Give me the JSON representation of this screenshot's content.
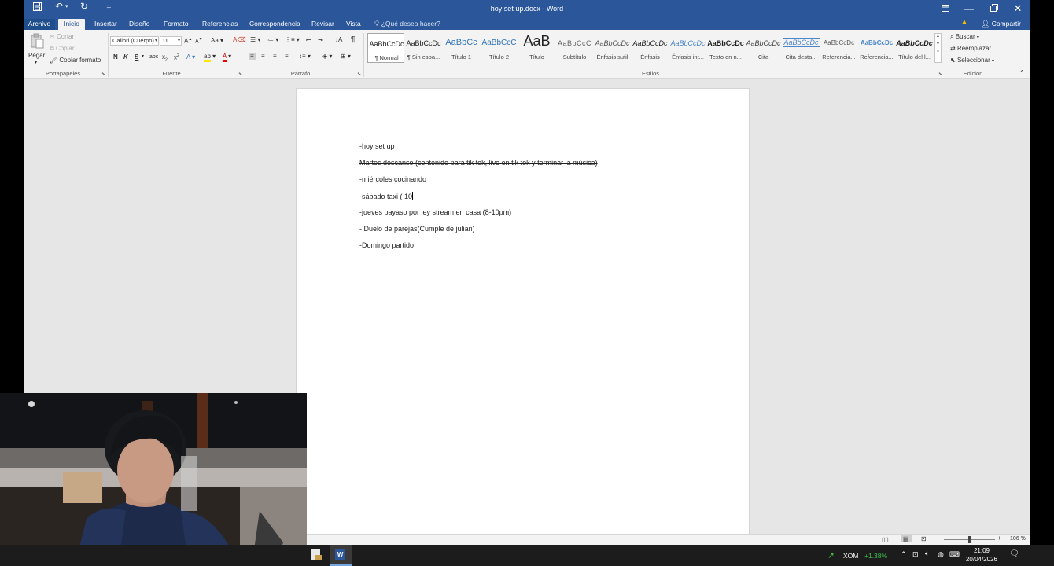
{
  "window": {
    "title": "hoy set up.docx - Word"
  },
  "tabs": [
    {
      "label": "Archivo"
    },
    {
      "label": "Inicio"
    },
    {
      "label": "Insertar"
    },
    {
      "label": "Diseño"
    },
    {
      "label": "Formato"
    },
    {
      "label": "Referencias"
    },
    {
      "label": "Correspondencia"
    },
    {
      "label": "Revisar"
    },
    {
      "label": "Vista"
    }
  ],
  "tell_me": "¿Qué desea hacer?",
  "share_label": "Compartir",
  "ribbon": {
    "clipboard": {
      "paste": "Pegar",
      "cut": "Cortar",
      "copy": "Copiar",
      "format_painter": "Copiar formato",
      "group": "Portapapeles"
    },
    "font": {
      "family": "Calibri (Cuerpo)",
      "size": "11",
      "group": "Fuente"
    },
    "paragraph": {
      "group": "Párrafo"
    },
    "styles": {
      "group": "Estilos",
      "items": [
        {
          "preview": "AaBbCcDc",
          "name": "¶ Normal"
        },
        {
          "preview": "AaBbCcDc",
          "name": "¶ Sin espa..."
        },
        {
          "preview": "AaBbCc",
          "name": "Título 1"
        },
        {
          "preview": "AaBbCcC",
          "name": "Título 2"
        },
        {
          "preview": "AaB",
          "name": "Título"
        },
        {
          "preview": "AaBbCcC",
          "name": "Subtítulo"
        },
        {
          "preview": "AaBbCcDc",
          "name": "Énfasis sutil"
        },
        {
          "preview": "AaBbCcDc",
          "name": "Énfasis"
        },
        {
          "preview": "AaBbCcDc",
          "name": "Énfasis int..."
        },
        {
          "preview": "AaBbCcDc",
          "name": "Texto en n..."
        },
        {
          "preview": "AaBbCcDc",
          "name": "Cita"
        },
        {
          "preview": "AaBbCcDc",
          "name": "Cita desta..."
        },
        {
          "preview": "AaBbCcDc",
          "name": "Referencia..."
        },
        {
          "preview": "AaBbCcDc",
          "name": "Referencia..."
        },
        {
          "preview": "AaBbCcDc",
          "name": "Título del l..."
        }
      ]
    },
    "editing": {
      "find": "Buscar",
      "replace": "Reemplazar",
      "select": "Seleccionar",
      "group": "Edición"
    }
  },
  "document": {
    "lines": [
      {
        "text": "-hoy set up"
      },
      {
        "text": "Martes descanso (contenido para tik tok, live en tik tok y terminar la música)"
      },
      {
        "text": "-miércoles cocinando"
      },
      {
        "text": "-sábado taxi ( 10"
      },
      {
        "text": "-jueves payaso por ley stream en casa (8-10pm)"
      },
      {
        "text": "- Duelo de parejas(Cumple de julian)"
      },
      {
        "text": "-Domingo partido"
      }
    ]
  },
  "status": {
    "zoom": "106 %"
  },
  "taskbar": {
    "ticker": "XOM",
    "change": "+1.38%",
    "time": "21:09",
    "date": "20/04/2026"
  },
  "colors": {
    "word_blue": "#2b579a",
    "ticker_green": "#3fc04a"
  }
}
